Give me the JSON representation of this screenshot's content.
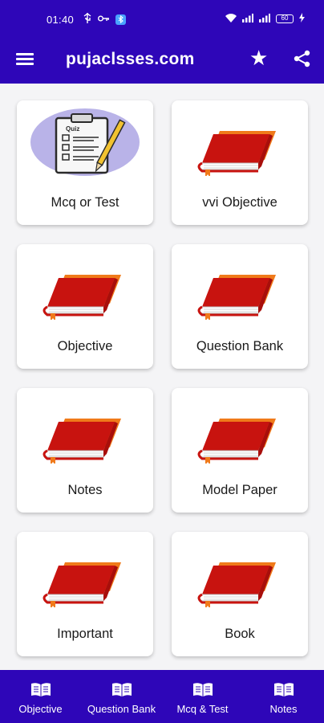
{
  "status_bar": {
    "time": "01:40",
    "battery_level": "60",
    "left_icons": [
      "usb-icon",
      "key-icon",
      "bluetooth-icon"
    ],
    "right_icons": [
      "wifi-icon",
      "signal-icon",
      "signal-icon",
      "battery-icon",
      "charging-icon"
    ]
  },
  "app_bar": {
    "title": "pujaclsses.com",
    "menu_icon": "menu-icon",
    "star_icon": "star-icon",
    "share_icon": "share-icon"
  },
  "cards": [
    {
      "label": "Mcq or Test",
      "icon": "quiz-icon"
    },
    {
      "label": "vvi Objective",
      "icon": "book-icon"
    },
    {
      "label": "Objective",
      "icon": "book-icon"
    },
    {
      "label": "Question Bank",
      "icon": "book-icon"
    },
    {
      "label": "Notes",
      "icon": "book-icon"
    },
    {
      "label": "Model Paper",
      "icon": "book-icon"
    },
    {
      "label": "Important",
      "icon": "book-icon"
    },
    {
      "label": "Book",
      "icon": "book-icon"
    }
  ],
  "bottom_nav": [
    {
      "label": "Objective",
      "icon": "open-book-icon"
    },
    {
      "label": "Question Bank",
      "icon": "open-book-icon"
    },
    {
      "label": "Mcq & Test",
      "icon": "open-book-icon"
    },
    {
      "label": "Notes",
      "icon": "open-book-icon"
    }
  ],
  "colors": {
    "primary": "#2e06b8",
    "book_red": "#c8130f",
    "book_orange": "#f07a1a",
    "quiz_bg": "#b9b3e8"
  },
  "quiz_icon_text": "Quiz"
}
